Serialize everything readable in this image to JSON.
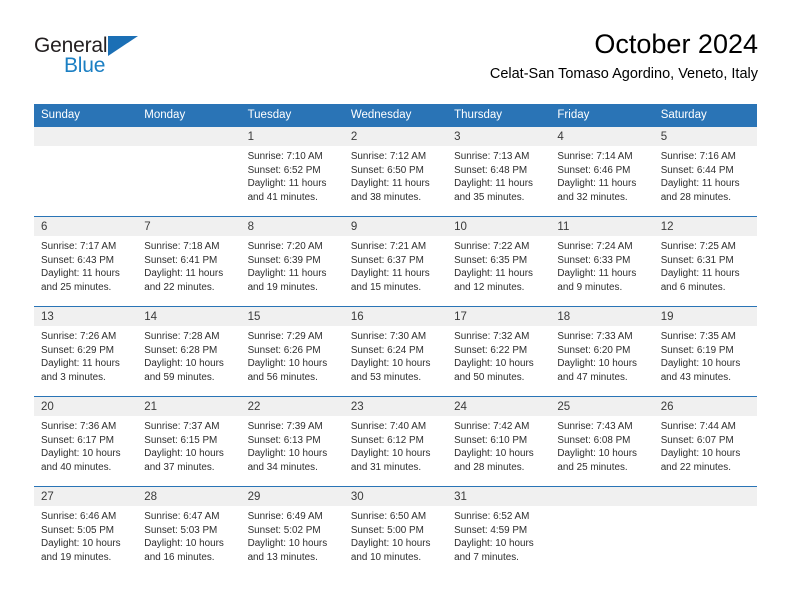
{
  "brand": {
    "name_top": "General",
    "name_bottom": "Blue",
    "triangle_icon": "brand-triangle-icon",
    "accent_color": "#1b6fb5"
  },
  "header": {
    "title": "October 2024",
    "location": "Celat-San Tomaso Agordino, Veneto, Italy"
  },
  "colors": {
    "header_blue": "#2a74b6",
    "daynum_band": "#f0f0f0",
    "text": "#2e2e2e"
  },
  "weekdays": [
    "Sunday",
    "Monday",
    "Tuesday",
    "Wednesday",
    "Thursday",
    "Friday",
    "Saturday"
  ],
  "labels": {
    "sunrise_prefix": "Sunrise:",
    "sunset_prefix": "Sunset:",
    "daylight_prefix": "Daylight:"
  },
  "weeks": [
    [
      {
        "day": "",
        "lines": []
      },
      {
        "day": "",
        "lines": []
      },
      {
        "day": "1",
        "lines": [
          "Sunrise: 7:10 AM",
          "Sunset: 6:52 PM",
          "Daylight: 11 hours",
          "and 41 minutes."
        ]
      },
      {
        "day": "2",
        "lines": [
          "Sunrise: 7:12 AM",
          "Sunset: 6:50 PM",
          "Daylight: 11 hours",
          "and 38 minutes."
        ]
      },
      {
        "day": "3",
        "lines": [
          "Sunrise: 7:13 AM",
          "Sunset: 6:48 PM",
          "Daylight: 11 hours",
          "and 35 minutes."
        ]
      },
      {
        "day": "4",
        "lines": [
          "Sunrise: 7:14 AM",
          "Sunset: 6:46 PM",
          "Daylight: 11 hours",
          "and 32 minutes."
        ]
      },
      {
        "day": "5",
        "lines": [
          "Sunrise: 7:16 AM",
          "Sunset: 6:44 PM",
          "Daylight: 11 hours",
          "and 28 minutes."
        ]
      }
    ],
    [
      {
        "day": "6",
        "lines": [
          "Sunrise: 7:17 AM",
          "Sunset: 6:43 PM",
          "Daylight: 11 hours",
          "and 25 minutes."
        ]
      },
      {
        "day": "7",
        "lines": [
          "Sunrise: 7:18 AM",
          "Sunset: 6:41 PM",
          "Daylight: 11 hours",
          "and 22 minutes."
        ]
      },
      {
        "day": "8",
        "lines": [
          "Sunrise: 7:20 AM",
          "Sunset: 6:39 PM",
          "Daylight: 11 hours",
          "and 19 minutes."
        ]
      },
      {
        "day": "9",
        "lines": [
          "Sunrise: 7:21 AM",
          "Sunset: 6:37 PM",
          "Daylight: 11 hours",
          "and 15 minutes."
        ]
      },
      {
        "day": "10",
        "lines": [
          "Sunrise: 7:22 AM",
          "Sunset: 6:35 PM",
          "Daylight: 11 hours",
          "and 12 minutes."
        ]
      },
      {
        "day": "11",
        "lines": [
          "Sunrise: 7:24 AM",
          "Sunset: 6:33 PM",
          "Daylight: 11 hours",
          "and 9 minutes."
        ]
      },
      {
        "day": "12",
        "lines": [
          "Sunrise: 7:25 AM",
          "Sunset: 6:31 PM",
          "Daylight: 11 hours",
          "and 6 minutes."
        ]
      }
    ],
    [
      {
        "day": "13",
        "lines": [
          "Sunrise: 7:26 AM",
          "Sunset: 6:29 PM",
          "Daylight: 11 hours",
          "and 3 minutes."
        ]
      },
      {
        "day": "14",
        "lines": [
          "Sunrise: 7:28 AM",
          "Sunset: 6:28 PM",
          "Daylight: 10 hours",
          "and 59 minutes."
        ]
      },
      {
        "day": "15",
        "lines": [
          "Sunrise: 7:29 AM",
          "Sunset: 6:26 PM",
          "Daylight: 10 hours",
          "and 56 minutes."
        ]
      },
      {
        "day": "16",
        "lines": [
          "Sunrise: 7:30 AM",
          "Sunset: 6:24 PM",
          "Daylight: 10 hours",
          "and 53 minutes."
        ]
      },
      {
        "day": "17",
        "lines": [
          "Sunrise: 7:32 AM",
          "Sunset: 6:22 PM",
          "Daylight: 10 hours",
          "and 50 minutes."
        ]
      },
      {
        "day": "18",
        "lines": [
          "Sunrise: 7:33 AM",
          "Sunset: 6:20 PM",
          "Daylight: 10 hours",
          "and 47 minutes."
        ]
      },
      {
        "day": "19",
        "lines": [
          "Sunrise: 7:35 AM",
          "Sunset: 6:19 PM",
          "Daylight: 10 hours",
          "and 43 minutes."
        ]
      }
    ],
    [
      {
        "day": "20",
        "lines": [
          "Sunrise: 7:36 AM",
          "Sunset: 6:17 PM",
          "Daylight: 10 hours",
          "and 40 minutes."
        ]
      },
      {
        "day": "21",
        "lines": [
          "Sunrise: 7:37 AM",
          "Sunset: 6:15 PM",
          "Daylight: 10 hours",
          "and 37 minutes."
        ]
      },
      {
        "day": "22",
        "lines": [
          "Sunrise: 7:39 AM",
          "Sunset: 6:13 PM",
          "Daylight: 10 hours",
          "and 34 minutes."
        ]
      },
      {
        "day": "23",
        "lines": [
          "Sunrise: 7:40 AM",
          "Sunset: 6:12 PM",
          "Daylight: 10 hours",
          "and 31 minutes."
        ]
      },
      {
        "day": "24",
        "lines": [
          "Sunrise: 7:42 AM",
          "Sunset: 6:10 PM",
          "Daylight: 10 hours",
          "and 28 minutes."
        ]
      },
      {
        "day": "25",
        "lines": [
          "Sunrise: 7:43 AM",
          "Sunset: 6:08 PM",
          "Daylight: 10 hours",
          "and 25 minutes."
        ]
      },
      {
        "day": "26",
        "lines": [
          "Sunrise: 7:44 AM",
          "Sunset: 6:07 PM",
          "Daylight: 10 hours",
          "and 22 minutes."
        ]
      }
    ],
    [
      {
        "day": "27",
        "lines": [
          "Sunrise: 6:46 AM",
          "Sunset: 5:05 PM",
          "Daylight: 10 hours",
          "and 19 minutes."
        ]
      },
      {
        "day": "28",
        "lines": [
          "Sunrise: 6:47 AM",
          "Sunset: 5:03 PM",
          "Daylight: 10 hours",
          "and 16 minutes."
        ]
      },
      {
        "day": "29",
        "lines": [
          "Sunrise: 6:49 AM",
          "Sunset: 5:02 PM",
          "Daylight: 10 hours",
          "and 13 minutes."
        ]
      },
      {
        "day": "30",
        "lines": [
          "Sunrise: 6:50 AM",
          "Sunset: 5:00 PM",
          "Daylight: 10 hours",
          "and 10 minutes."
        ]
      },
      {
        "day": "31",
        "lines": [
          "Sunrise: 6:52 AM",
          "Sunset: 4:59 PM",
          "Daylight: 10 hours",
          "and 7 minutes."
        ]
      },
      {
        "day": "",
        "lines": []
      },
      {
        "day": "",
        "lines": []
      }
    ]
  ]
}
